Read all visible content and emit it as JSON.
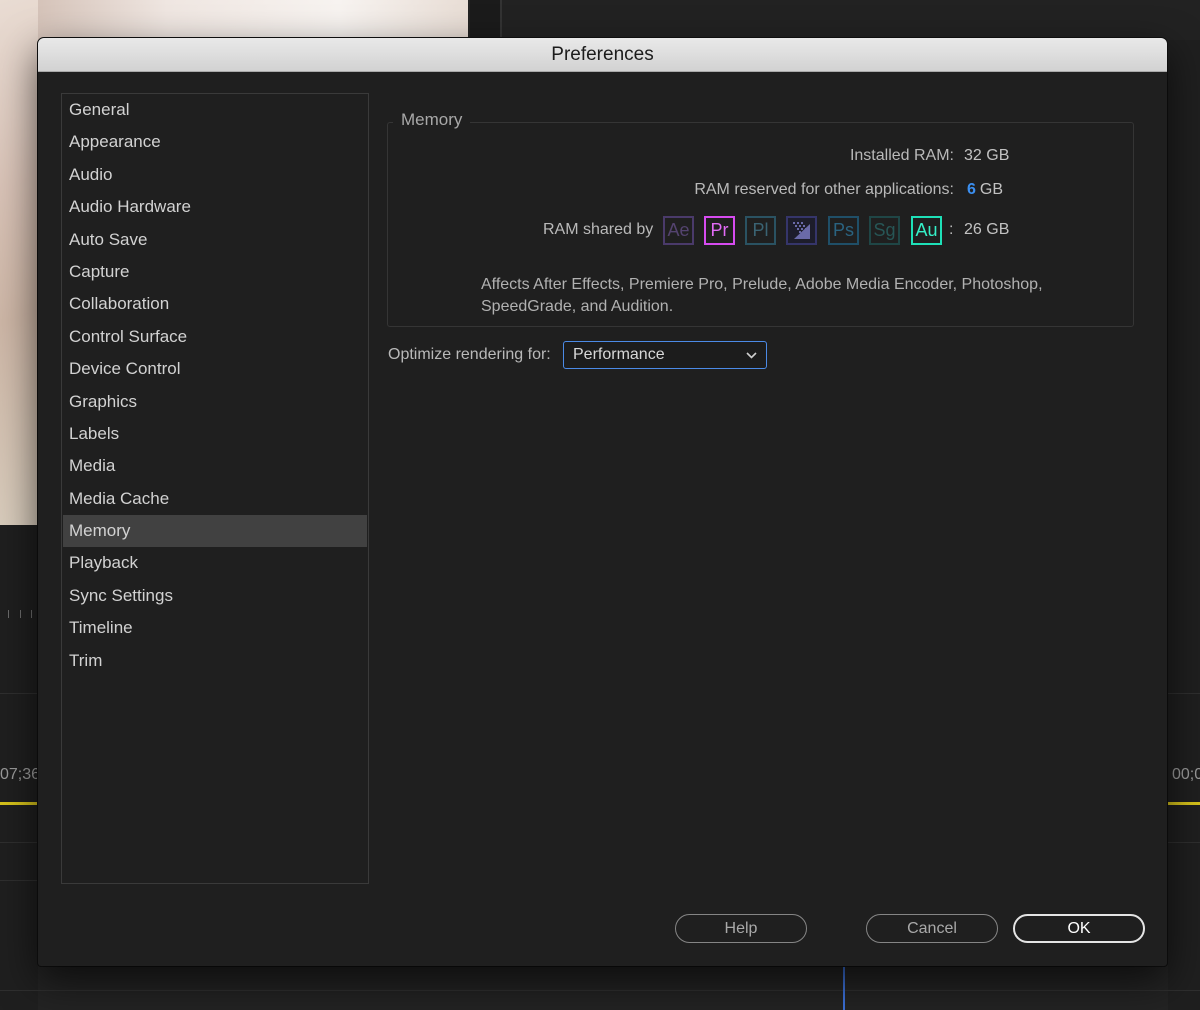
{
  "background": {
    "timecode_left": "07;36",
    "timecode_right": "00;0"
  },
  "dialog": {
    "title": "Preferences"
  },
  "sidebar": {
    "items": [
      {
        "label": "General"
      },
      {
        "label": "Appearance"
      },
      {
        "label": "Audio"
      },
      {
        "label": "Audio Hardware"
      },
      {
        "label": "Auto Save"
      },
      {
        "label": "Capture"
      },
      {
        "label": "Collaboration"
      },
      {
        "label": "Control Surface"
      },
      {
        "label": "Device Control"
      },
      {
        "label": "Graphics"
      },
      {
        "label": "Labels"
      },
      {
        "label": "Media"
      },
      {
        "label": "Media Cache"
      },
      {
        "label": "Memory"
      },
      {
        "label": "Playback"
      },
      {
        "label": "Sync Settings"
      },
      {
        "label": "Timeline"
      },
      {
        "label": "Trim"
      }
    ],
    "selected": "Memory"
  },
  "memory": {
    "group_label": "Memory",
    "installed_label": "Installed RAM:",
    "installed_value": "32 GB",
    "reserved_label": "RAM reserved for other applications:",
    "reserved_number": "6",
    "reserved_unit": "GB",
    "shared_label": "RAM shared by",
    "shared_colon": ":",
    "shared_value": "26 GB",
    "apps": [
      {
        "label": "Ae",
        "color": "#4a3a6a",
        "active": false
      },
      {
        "label": "Pr",
        "color": "#d64bf0",
        "active": true
      },
      {
        "label": "Pl",
        "color": "#2a5a6a",
        "active": false
      },
      {
        "label": "",
        "icon": "media-encoder-icon",
        "color": "#3a3a6a",
        "active": false
      },
      {
        "label": "Ps",
        "color": "#1f5c7a",
        "active": false
      },
      {
        "label": "Sg",
        "color": "#1f4f4f",
        "active": false
      },
      {
        "label": "Au",
        "color": "#1ee0b8",
        "active": true
      }
    ],
    "description": "Affects After Effects, Premiere Pro, Prelude, Adobe Media Encoder, Photoshop, SpeedGrade, and Audition."
  },
  "optimize": {
    "label": "Optimize rendering for:",
    "value": "Performance"
  },
  "buttons": {
    "help": "Help",
    "cancel": "Cancel",
    "ok": "OK"
  },
  "colors": {
    "accent_blue": "#3b8ff0",
    "focus_border": "#4b8ae6",
    "selected_row": "#414141"
  }
}
